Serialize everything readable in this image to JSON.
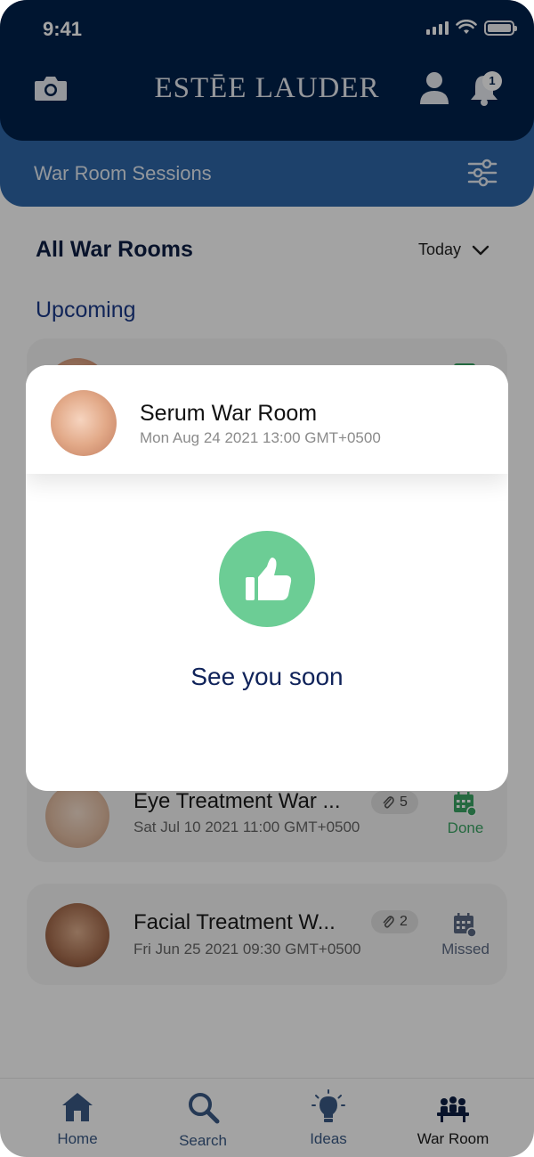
{
  "status_bar": {
    "time": "9:41"
  },
  "header": {
    "brand": "ESTĒE LAUDER",
    "notification_count": "1"
  },
  "subheader": {
    "title": "War Room Sessions"
  },
  "main": {
    "section_title": "All War Rooms",
    "date_filter": "Today",
    "upcoming_label": "Upcoming",
    "cards": [
      {
        "title": "Eye Treatment War ...",
        "date": "Sat Jul 10 2021 11:00 GMT+0500",
        "attachments": "5",
        "status": "Done",
        "status_color": "#3aa564"
      },
      {
        "title": "Facial Treatment W...",
        "date": "Fri Jun 25 2021 09:30 GMT+0500",
        "attachments": "2",
        "status": "Missed",
        "status_color": "#5c6a84"
      }
    ]
  },
  "modal": {
    "title": "Serum War Room",
    "date": "Mon Aug 24 2021 13:00 GMT+0500",
    "message": "See you soon",
    "icon": "thumbs-up-icon",
    "icon_bg": "#6ccd95"
  },
  "tabs": [
    {
      "label": "Home",
      "icon": "home-icon"
    },
    {
      "label": "Search",
      "icon": "search-icon"
    },
    {
      "label": "Ideas",
      "icon": "lightbulb-icon"
    },
    {
      "label": "War Room",
      "icon": "meeting-icon",
      "active": true
    }
  ],
  "colors": {
    "header_bg": "#01214b",
    "subheader_bg": "#2e66a8",
    "accent_green": "#6ccd95"
  }
}
